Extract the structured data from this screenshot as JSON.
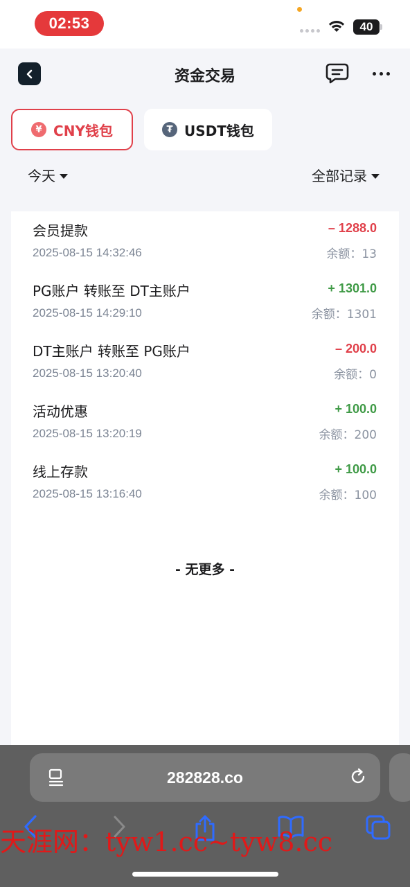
{
  "status_bar": {
    "time": "02:53",
    "battery": "40"
  },
  "header": {
    "title": "资金交易"
  },
  "wallet_tabs": [
    {
      "label": "CNY钱包",
      "icon": "¥",
      "active": true
    },
    {
      "label": "USDT钱包",
      "icon": "₮",
      "active": false
    }
  ],
  "filters": {
    "date": "今天",
    "type": "全部记录"
  },
  "records": [
    {
      "title": "会员提款",
      "time": "2025-08-15 14:32:46",
      "amount": "– 1288.0",
      "sign": "negative",
      "balance": "余额：13"
    },
    {
      "title": "PG账户  转账至  DT主账户",
      "time": "2025-08-15 14:29:10",
      "amount": "+ 1301.0",
      "sign": "positive",
      "balance": "余额：1301"
    },
    {
      "title": "DT主账户  转账至  PG账户",
      "time": "2025-08-15 13:20:40",
      "amount": "– 200.0",
      "sign": "negative",
      "balance": "余额：0"
    },
    {
      "title": "活动优惠",
      "time": "2025-08-15 13:20:19",
      "amount": "+ 100.0",
      "sign": "positive",
      "balance": "余额：200"
    },
    {
      "title": "线上存款",
      "time": "2025-08-15 13:16:40",
      "amount": "+ 100.0",
      "sign": "positive",
      "balance": "余额：100"
    }
  ],
  "no_more_text": "- 无更多 -",
  "browser": {
    "url": "282828.co"
  },
  "watermark": "天涯网：tyw1.cc~tyw8.cc",
  "colors": {
    "accent_red": "#e0404a",
    "positive_green": "#3f9a46",
    "status_time_pill": "#e5393b"
  }
}
